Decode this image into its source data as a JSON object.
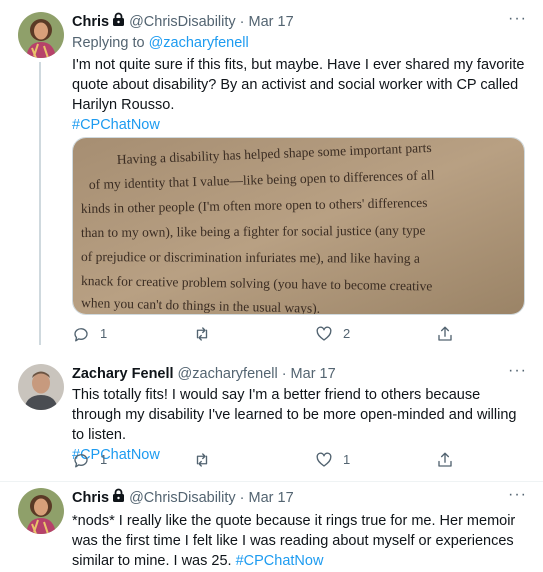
{
  "tweets": [
    {
      "name": "Chris",
      "handle": "@ChrisDisability",
      "date": "Mar 17",
      "reply_prefix": "Replying to",
      "reply_to": "@zacharyfenell",
      "text": "I'm not quite sure if this fits, but maybe. Have I ever shared my favorite quote about disability? By an activist and social worker with CP called Harilyn Rousso.",
      "hashtag": "#CPChatNow",
      "image_text": [
        "Having a disability has helped shape some important parts",
        "of my identity that I value—like being open to differences of all",
        "kinds in other people (I'm often more open to others' differences",
        "than to my own), like being a fighter for social justice (any type",
        "of prejudice or discrimination infuriates me), and like having a",
        "knack for creative problem solving (you have to become creative",
        "when you can't do things in the usual ways)."
      ],
      "replies": "1",
      "retweets": "",
      "likes": "2"
    },
    {
      "name": "Zachary Fenell",
      "handle": "@zacharyfenell",
      "date": "Mar 17",
      "text": "This totally fits! I would say I'm a better friend to others because through my disability I've learned to be more open-minded and willing to listen.",
      "hashtag": "#CPChatNow",
      "replies": "1",
      "retweets": "",
      "likes": "1"
    },
    {
      "name": "Chris",
      "handle": "@ChrisDisability",
      "date": "Mar 17",
      "text": "*nods* I really like the quote because it rings true for me. Her memoir was the first time I felt like I was reading about myself or experiences similar to mine. I was 25.",
      "hashtag": "#CPChatNow"
    }
  ],
  "icons": {
    "protected": "lock-icon",
    "more": "more-icon",
    "reply": "reply-icon",
    "retweet": "retweet-icon",
    "like": "like-icon",
    "share": "share-icon"
  },
  "colors": {
    "link": "#1d9bf0",
    "secondary": "#536471",
    "text": "#0f1419",
    "thread_line": "#cfd9de"
  }
}
